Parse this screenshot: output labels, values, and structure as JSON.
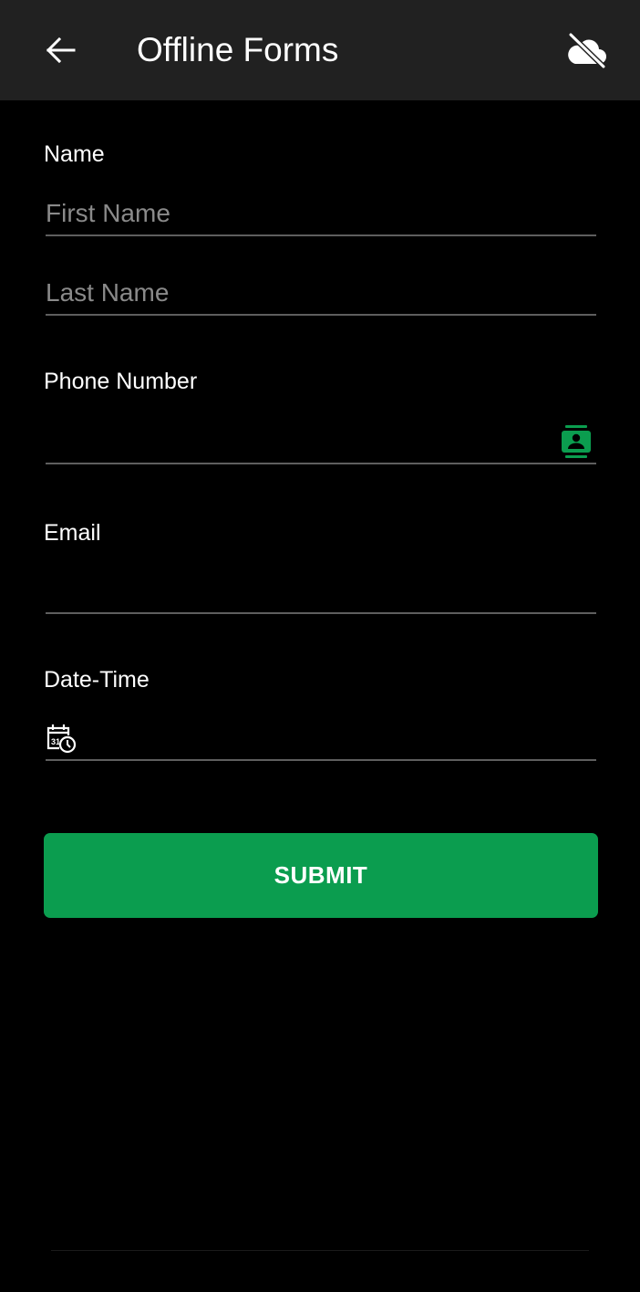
{
  "app_bar": {
    "title": "Offline Forms",
    "back_icon": "arrow-left-icon",
    "status_icon": "cloud-off-icon",
    "background": "#212121"
  },
  "form": {
    "name": {
      "label": "Name",
      "first_name": {
        "value": "",
        "placeholder": "First Name"
      },
      "last_name": {
        "value": "",
        "placeholder": "Last Name"
      }
    },
    "phone": {
      "label": "Phone Number",
      "value": "",
      "picker_icon": "contacts-icon"
    },
    "email": {
      "label": "Email",
      "value": ""
    },
    "date_time": {
      "label": "Date-Time",
      "value": "",
      "picker_icon": "calendar-clock-icon"
    },
    "submit_label": "SUBMIT"
  },
  "colors": {
    "accent": "#0b9d4f",
    "background": "#000000",
    "underline": "#5e5e5e"
  }
}
